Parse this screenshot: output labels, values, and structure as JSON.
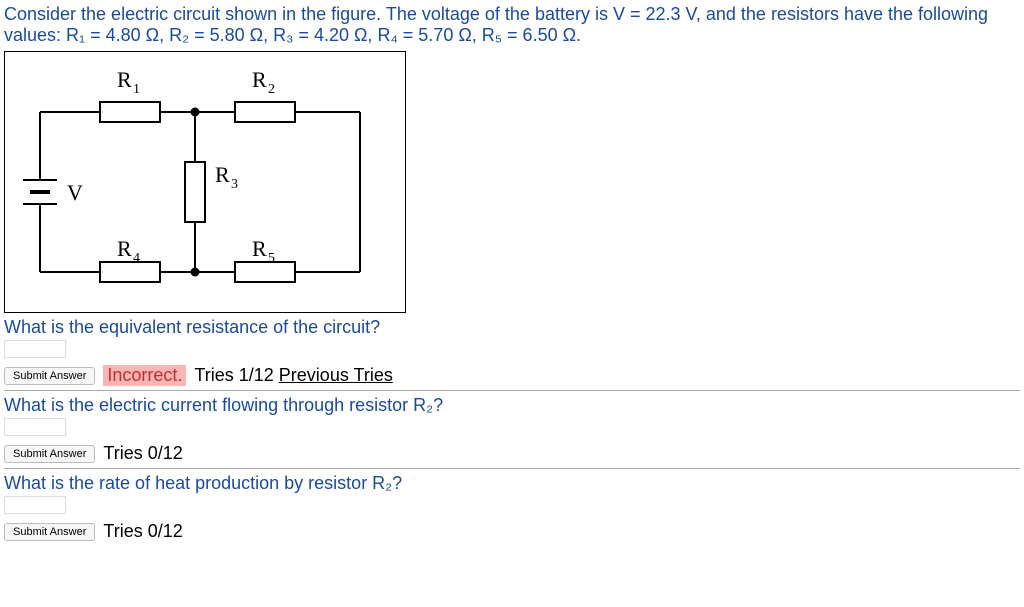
{
  "problem_statement": "Consider the electric circuit shown in the figure. The voltage of the battery is V = 22.3 V, and the resistors have the following values: R₁ = 4.80 Ω, R₂ = 5.80 Ω, R₃ = 4.20 Ω, R₄ = 5.70 Ω, R₅ = 6.50 Ω.",
  "diagram_labels": {
    "R1": "R",
    "R1_sub": "1",
    "R2": "R",
    "R2_sub": "2",
    "R3": "R",
    "R3_sub": "3",
    "R4": "R",
    "R4_sub": "4",
    "R5": "R",
    "R5_sub": "5",
    "V": "V"
  },
  "q1": {
    "text": "What is the equivalent resistance of the circuit?",
    "submit": "Submit Answer",
    "status": "Incorrect.",
    "tries": "Tries 1/12",
    "prev": "Previous Tries"
  },
  "q2": {
    "text": "What is the electric current flowing through resistor R₂?",
    "submit": "Submit Answer",
    "tries": "Tries 0/12"
  },
  "q3": {
    "text": "What is the rate of heat production by resistor R₂?",
    "submit": "Submit Answer",
    "tries": "Tries 0/12"
  }
}
